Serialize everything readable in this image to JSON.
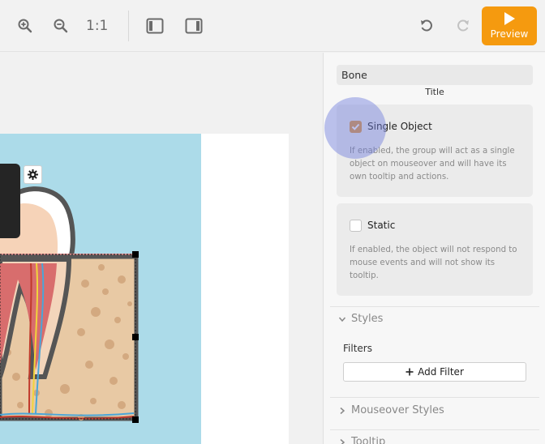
{
  "toolbar": {
    "zoom_reset_label": "1:1",
    "preview_label": "Preview",
    "accent_color": "#f59a0f",
    "icons": [
      "zoom-in-icon",
      "zoom-out-icon",
      "toggle-left-panel-icon",
      "toggle-right-panel-icon",
      "undo-icon",
      "redo-icon",
      "play-icon"
    ]
  },
  "canvas": {
    "background_color": "#acdbe9"
  },
  "panel": {
    "title_value": "Bone",
    "title_label": "Title",
    "single_object": {
      "label": "Single Object",
      "checked": true,
      "description": "If enabled, the group will act as a single object on mouseover and will have its own tooltip and actions."
    },
    "static": {
      "label": "Static",
      "checked": false,
      "description": "If enabled, the object will not respond to mouse events and will not show its tooltip."
    },
    "sections": {
      "styles": "Styles",
      "filters_label": "Filters",
      "add_filter": "Add Filter",
      "mouseover_styles": "Mouseover Styles",
      "tooltip": "Tooltip"
    }
  }
}
